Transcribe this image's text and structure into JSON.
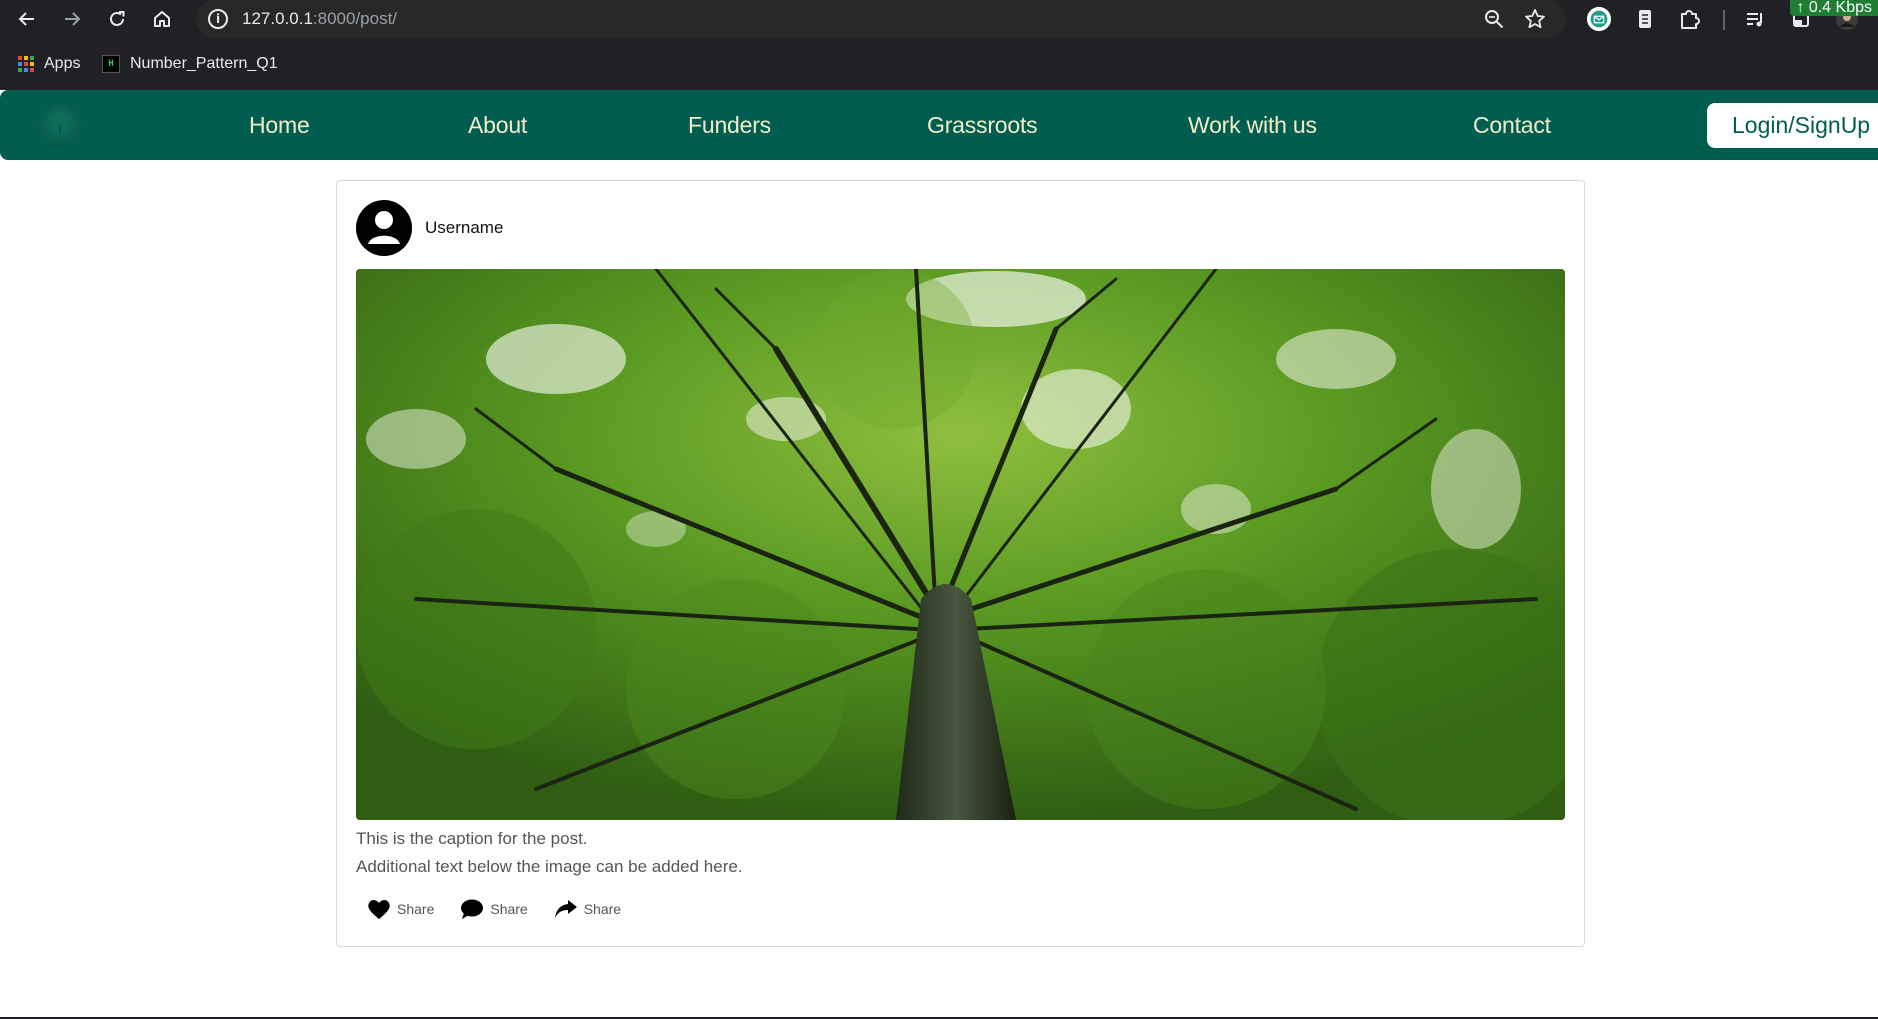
{
  "browser": {
    "url_host": "127.0.0.1",
    "url_rest": ":8000/post/",
    "network_speed": "↑ 0.4 Kbps",
    "bookmarks": [
      {
        "label": "Apps",
        "icon": "apps-grid-icon"
      },
      {
        "label": "Number_Pattern_Q1",
        "icon": "hackerrank-icon"
      }
    ]
  },
  "navbar": {
    "links": [
      "Home",
      "About",
      "Funders",
      "Grassroots",
      "Work with us",
      "Contact"
    ],
    "login_label": "Login/SignUp"
  },
  "post": {
    "username": "Username",
    "image": "tree-canopy-photo",
    "caption": "This is the caption for the post.",
    "additional_text": "Additional text below the image can be added here.",
    "actions": [
      {
        "icon": "heart-icon",
        "label": "Share"
      },
      {
        "icon": "comment-icon",
        "label": "Share"
      },
      {
        "icon": "share-arrow-icon",
        "label": "Share"
      }
    ]
  },
  "colors": {
    "navbar_bg": "#005d4f",
    "nav_text": "#f3edc8",
    "chrome_bg": "#202124",
    "network_badge": "#1e7e34"
  }
}
